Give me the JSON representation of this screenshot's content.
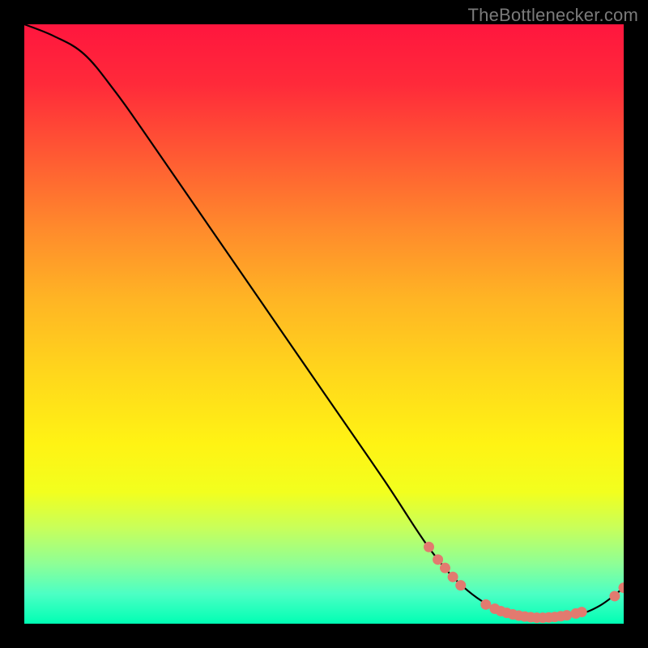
{
  "watermark": "TheBottlenecker.com",
  "chart_data": {
    "type": "line",
    "title": "",
    "xlabel": "",
    "ylabel": "",
    "xlim": [
      0,
      100
    ],
    "ylim": [
      0,
      100
    ],
    "curve": [
      {
        "x": 0,
        "y": 100
      },
      {
        "x": 5,
        "y": 98
      },
      {
        "x": 10,
        "y": 95
      },
      {
        "x": 15,
        "y": 89
      },
      {
        "x": 20,
        "y": 82
      },
      {
        "x": 30,
        "y": 67.5
      },
      {
        "x": 40,
        "y": 53
      },
      {
        "x": 50,
        "y": 38.5
      },
      {
        "x": 60,
        "y": 24
      },
      {
        "x": 68,
        "y": 12
      },
      {
        "x": 74,
        "y": 5.5
      },
      {
        "x": 80,
        "y": 2
      },
      {
        "x": 86,
        "y": 1
      },
      {
        "x": 92,
        "y": 1.5
      },
      {
        "x": 96,
        "y": 3
      },
      {
        "x": 100,
        "y": 6
      }
    ],
    "dots": [
      {
        "x": 67.5,
        "y": 12.8
      },
      {
        "x": 69.0,
        "y": 10.7
      },
      {
        "x": 70.2,
        "y": 9.3
      },
      {
        "x": 71.5,
        "y": 7.8
      },
      {
        "x": 72.8,
        "y": 6.4
      },
      {
        "x": 77.0,
        "y": 3.2
      },
      {
        "x": 78.5,
        "y": 2.5
      },
      {
        "x": 79.5,
        "y": 2.1
      },
      {
        "x": 80.5,
        "y": 1.8
      },
      {
        "x": 81.5,
        "y": 1.55
      },
      {
        "x": 82.5,
        "y": 1.35
      },
      {
        "x": 83.5,
        "y": 1.2
      },
      {
        "x": 84.5,
        "y": 1.08
      },
      {
        "x": 85.5,
        "y": 1.0
      },
      {
        "x": 86.5,
        "y": 1.0
      },
      {
        "x": 87.5,
        "y": 1.04
      },
      {
        "x": 88.5,
        "y": 1.12
      },
      {
        "x": 89.5,
        "y": 1.25
      },
      {
        "x": 90.5,
        "y": 1.4
      },
      {
        "x": 92.0,
        "y": 1.7
      },
      {
        "x": 93.0,
        "y": 1.95
      },
      {
        "x": 98.5,
        "y": 4.6
      },
      {
        "x": 100.0,
        "y": 6.0
      }
    ],
    "dot_color": "#e27a6f",
    "line_color": "#000000"
  }
}
